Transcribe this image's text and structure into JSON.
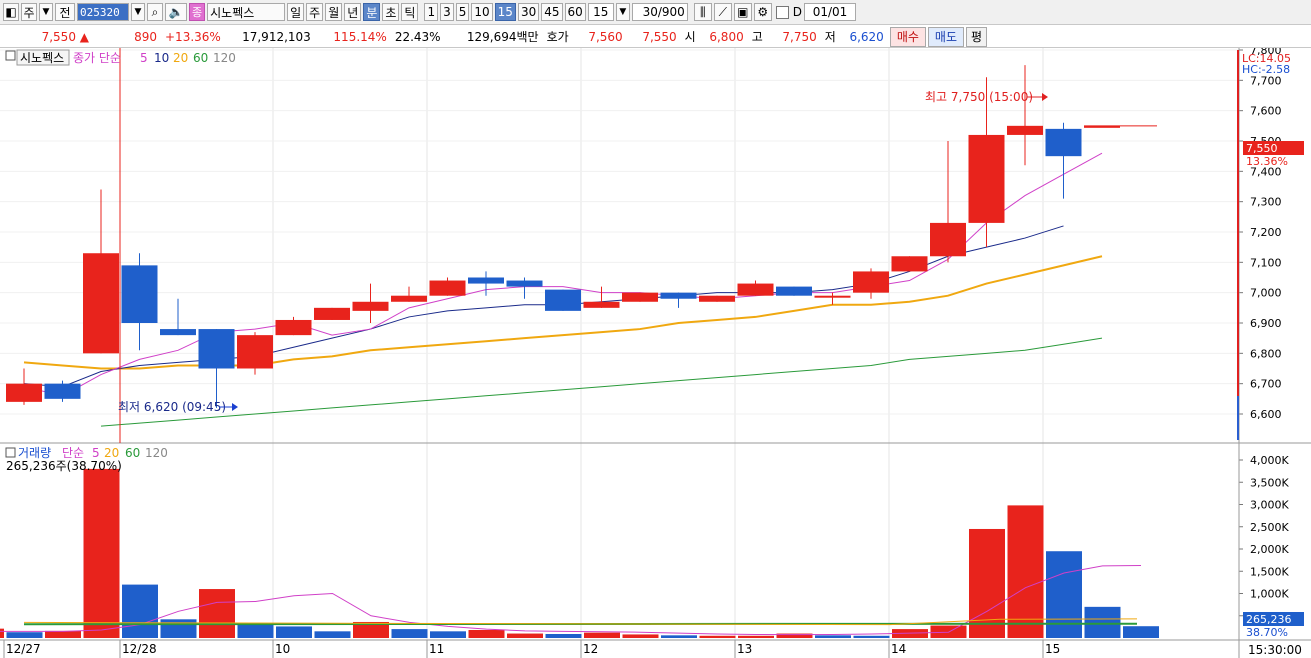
{
  "toolbar": {
    "items": [
      "주",
      "전"
    ],
    "code": "025320",
    "name": "시노펙스",
    "name_tag": "종",
    "periods": [
      "일",
      "주",
      "월",
      "년",
      "분",
      "초",
      "틱"
    ],
    "selected_period": "분",
    "intervals": [
      "1",
      "3",
      "5",
      "10",
      "15",
      "30",
      "45",
      "60"
    ],
    "selected_interval": "15",
    "interval_value": "15",
    "count": "30/900",
    "date_check": "D",
    "date": "01/01"
  },
  "info": {
    "price": "7,550",
    "change": "890",
    "change_pct": "+13.36%",
    "volume": "17,912,103",
    "vol_ratio": "115.14%",
    "turnover": "22.43%",
    "amount": "129,694백만",
    "ask_label": "호가",
    "ask": "7,560",
    "bid": "7,550",
    "open_label": "시",
    "open": "6,800",
    "high_label": "고",
    "high": "7,750",
    "low_label": "저",
    "low": "6,620",
    "buy": "매수",
    "sell": "매도",
    "avg": "평"
  },
  "price_panel": {
    "title": "시노펙스",
    "legend": {
      "label": "종가 단순",
      "ma": [
        "5",
        "10",
        "20",
        "60",
        "120"
      ]
    },
    "lc": "LC:14.05",
    "hc": "HC:-2.58",
    "y_ticks": [
      "7,800",
      "7,700",
      "7,600",
      "7,500",
      "7,400",
      "7,300",
      "7,200",
      "7,100",
      "7,000",
      "6,900",
      "6,800",
      "6,700",
      "6,600"
    ],
    "last_price": "7,550",
    "last_pct": "13.36%",
    "high_note": "최고 7,750 (15:00)",
    "low_note": "최저 6,620 (09:45)"
  },
  "volume_panel": {
    "legend": {
      "label": "거래량",
      "sub": "단순",
      "ma": [
        "5",
        "20",
        "60",
        "120"
      ]
    },
    "current": "265,236주(38.70%)",
    "y_ticks": [
      "4,000K",
      "3,500K",
      "3,000K",
      "2,500K",
      "2,000K",
      "1,500K",
      "1,000K",
      "500,000"
    ],
    "last_value": "265,236",
    "last_pct": "38.70%"
  },
  "x_axis": {
    "labels": [
      "12/27",
      "12/28",
      "10",
      "11",
      "12",
      "13",
      "14",
      "15"
    ],
    "time": "15:30:00"
  },
  "colors": {
    "up": "#e8231c",
    "down": "#1f5fcb",
    "ma5": "#d040c8",
    "ma10": "#1a2a8a",
    "ma20": "#f0a810",
    "ma60": "#2a9a3a"
  },
  "chart_data": {
    "type": "candlestick",
    "candles": [
      {
        "o": 6640,
        "h": 6750,
        "l": 6630,
        "c": 6700
      },
      {
        "o": 6700,
        "h": 6710,
        "l": 6640,
        "c": 6650
      },
      {
        "o": 6800,
        "h": 7340,
        "l": 6800,
        "c": 7130
      },
      {
        "o": 7090,
        "h": 7130,
        "l": 6810,
        "c": 6900
      },
      {
        "o": 6880,
        "h": 6980,
        "l": 6860,
        "c": 6860
      },
      {
        "o": 6880,
        "h": 6880,
        "l": 6620,
        "c": 6750
      },
      {
        "o": 6750,
        "h": 6870,
        "l": 6730,
        "c": 6860
      },
      {
        "o": 6860,
        "h": 6920,
        "l": 6860,
        "c": 6910
      },
      {
        "o": 6910,
        "h": 6950,
        "l": 6910,
        "c": 6950
      },
      {
        "o": 6940,
        "h": 7030,
        "l": 6900,
        "c": 6970
      },
      {
        "o": 6970,
        "h": 7020,
        "l": 6970,
        "c": 6990
      },
      {
        "o": 6990,
        "h": 7050,
        "l": 6990,
        "c": 7040
      },
      {
        "o": 7050,
        "h": 7070,
        "l": 6990,
        "c": 7030
      },
      {
        "o": 7040,
        "h": 7050,
        "l": 6980,
        "c": 7020
      },
      {
        "o": 7010,
        "h": 7010,
        "l": 6940,
        "c": 6940
      },
      {
        "o": 6950,
        "h": 7020,
        "l": 6950,
        "c": 6970
      },
      {
        "o": 6970,
        "h": 7000,
        "l": 6970,
        "c": 7000
      },
      {
        "o": 7000,
        "h": 7000,
        "l": 6950,
        "c": 6980
      },
      {
        "o": 6970,
        "h": 6990,
        "l": 6970,
        "c": 6990
      },
      {
        "o": 6990,
        "h": 7040,
        "l": 6990,
        "c": 7030
      },
      {
        "o": 7020,
        "h": 7020,
        "l": 6990,
        "c": 6990
      },
      {
        "o": 6990,
        "h": 7000,
        "l": 6960,
        "c": 6990
      },
      {
        "o": 7000,
        "h": 7080,
        "l": 6980,
        "c": 7070
      },
      {
        "o": 7070,
        "h": 7120,
        "l": 7070,
        "c": 7120
      },
      {
        "o": 7120,
        "h": 7500,
        "l": 7100,
        "c": 7230
      },
      {
        "o": 7230,
        "h": 7710,
        "l": 7150,
        "c": 7520
      },
      {
        "o": 7520,
        "h": 7750,
        "l": 7420,
        "c": 7550
      },
      {
        "o": 7540,
        "h": 7560,
        "l": 7310,
        "c": 7450
      },
      {
        "o": 7550,
        "h": 7550,
        "l": 7550,
        "c": 7550
      }
    ],
    "volume_k": [
      210,
      130,
      160,
      3800,
      1200,
      420,
      1100,
      300,
      260,
      150,
      360,
      200,
      150,
      180,
      100,
      90,
      120,
      80,
      60,
      50,
      50,
      100,
      60,
      50,
      200,
      280,
      2450,
      2980,
      1950,
      700,
      265
    ],
    "ma5": [
      6690,
      6660,
      6730,
      6780,
      6810,
      6870,
      6880,
      6900,
      6860,
      6880,
      6950,
      6980,
      7010,
      7020,
      7020,
      7000,
      7000,
      6990,
      6980,
      6990,
      7000,
      7000,
      7020,
      7040,
      7110,
      7230,
      7320,
      7390,
      7460
    ],
    "ma10": [
      6700,
      6690,
      6740,
      6760,
      6770,
      6780,
      6790,
      6820,
      6850,
      6880,
      6920,
      6940,
      6950,
      6960,
      6960,
      6970,
      6980,
      6990,
      7000,
      7000,
      7000,
      7010,
      7030,
      7070,
      7120,
      7150,
      7180,
      7220
    ],
    "ma20": [
      6770,
      6760,
      6750,
      6750,
      6760,
      6760,
      6760,
      6780,
      6790,
      6810,
      6820,
      6830,
      6840,
      6850,
      6860,
      6870,
      6880,
      6900,
      6910,
      6920,
      6940,
      6960,
      6960,
      6970,
      6990,
      7030,
      7060,
      7090,
      7120
    ],
    "ma60": [
      6560,
      6570,
      6580,
      6590,
      6600,
      6610,
      6620,
      6630,
      6640,
      6650,
      6660,
      6670,
      6680,
      6690,
      6700,
      6710,
      6720,
      6730,
      6740,
      6750,
      6760,
      6780,
      6790,
      6800,
      6810,
      6830,
      6850
    ]
  }
}
